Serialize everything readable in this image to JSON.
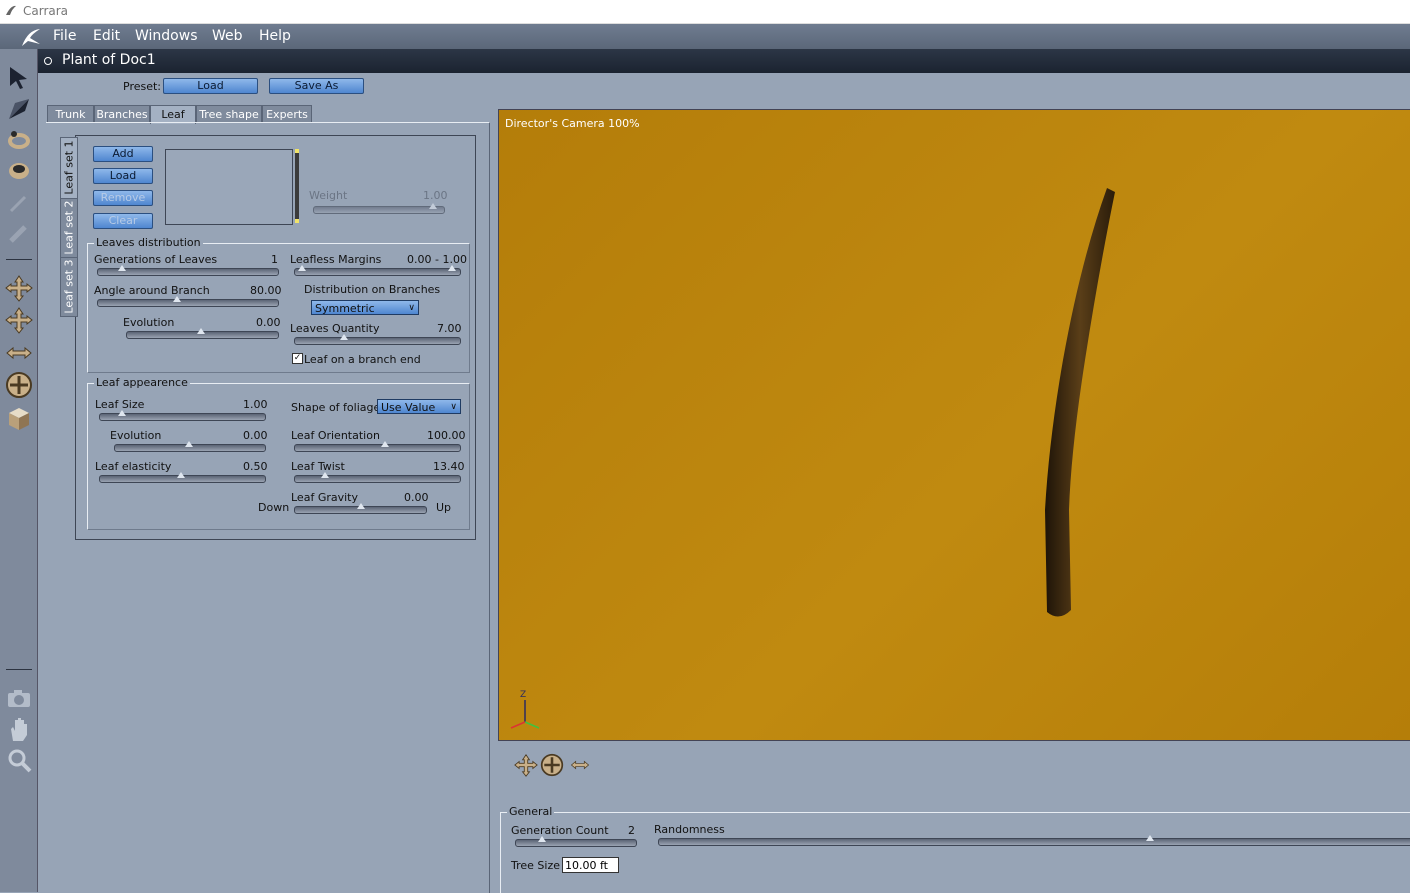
{
  "app": {
    "title": "Carrara"
  },
  "menu": {
    "file": "File",
    "edit": "Edit",
    "windows": "Windows",
    "web": "Web",
    "help": "Help"
  },
  "document": {
    "title": "Plant of Doc1"
  },
  "preset": {
    "label": "Preset:",
    "load": "Load",
    "save_as": "Save As"
  },
  "tabs": {
    "trunk": "Trunk",
    "branches": "Branches",
    "leaf": "Leaf",
    "tree_shape": "Tree shape",
    "experts": "Experts"
  },
  "leaf_sets": {
    "set1": "Leaf set 1",
    "set2": "Leaf set 2",
    "set3": "Leaf set 3"
  },
  "leaf_buttons": {
    "add": "Add",
    "load": "Load",
    "remove": "Remove",
    "clear": "Clear"
  },
  "weight": {
    "label": "Weight",
    "value": "1.00"
  },
  "leaves_distribution": {
    "title": "Leaves distribution",
    "generations_label": "Generations of Leaves",
    "generations_value": "1",
    "angle_label": "Angle around Branch",
    "angle_value": "80.00",
    "evolution_label": "Evolution",
    "evolution_value": "0.00",
    "leafless_label": "Leafless Margins",
    "leafless_value": "0.00 - 1.00",
    "distribution_label": "Distribution on Branches",
    "distribution_value": "Symmetric",
    "quantity_label": "Leaves Quantity",
    "quantity_value": "7.00",
    "branch_end_label": "Leaf on a branch end",
    "branch_end_checked": true
  },
  "leaf_appearance": {
    "title": "Leaf appearence",
    "size_label": "Leaf Size",
    "size_value": "1.00",
    "evolution_label": "Evolution",
    "evolution_value": "0.00",
    "elasticity_label": "Leaf elasticity",
    "elasticity_value": "0.50",
    "shape_label": "Shape of foliage",
    "shape_value": "Use Value",
    "orientation_label": "Leaf Orientation",
    "orientation_value": "100.00",
    "twist_label": "Leaf Twist",
    "twist_value": "13.40",
    "gravity_label": "Leaf Gravity",
    "gravity_value": "0.00",
    "down_label": "Down",
    "up_label": "Up"
  },
  "viewport": {
    "camera_label": "Director's Camera 100%",
    "axis_z": "Z",
    "background_color": "#b98208",
    "plant_color": "#3b2a12"
  },
  "general": {
    "title": "General",
    "generation_count_label": "Generation Count",
    "generation_count_value": "2",
    "randomness_label": "Randomness",
    "tree_size_label": "Tree Size",
    "tree_size_value": "10.00 ft"
  }
}
